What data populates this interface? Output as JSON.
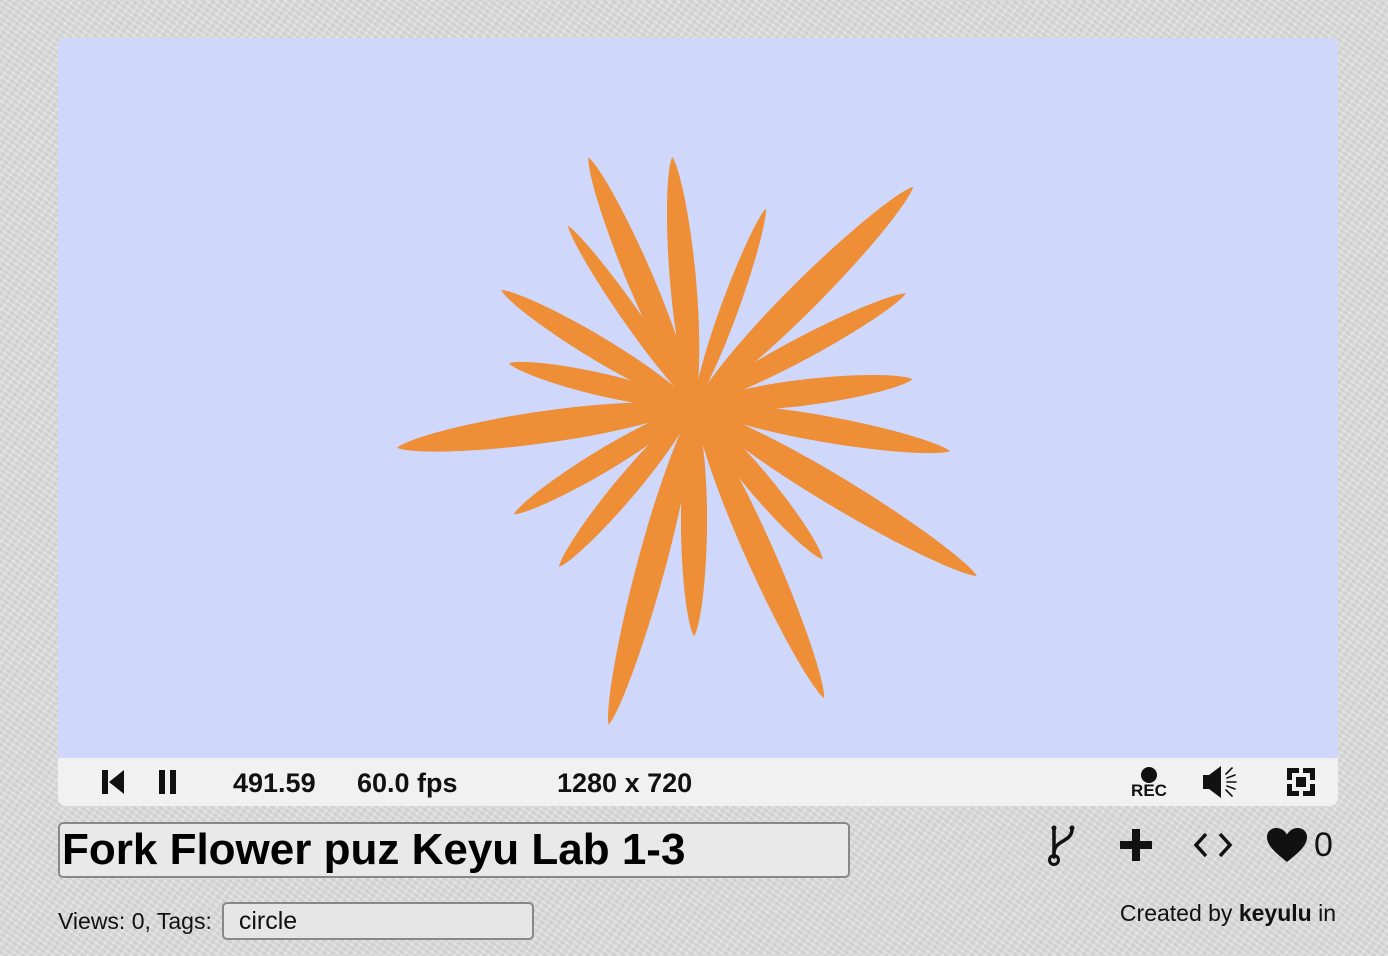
{
  "player": {
    "canvas_background": "#cfd8fa",
    "flower_color": "#ee8e36",
    "time": "491.59",
    "fps": "60.0 fps",
    "resolution": "1280 x 720",
    "rec_label": "REC"
  },
  "shader": {
    "title": "Fork Flower puz Keyu Lab 1-3",
    "views_label": "Views: 0, Tags:",
    "tags": "circle",
    "likes": "0",
    "created_by_label": "Created by",
    "author": "keyulu",
    "in_label": "in"
  },
  "icons": {
    "rewind": "skip-back-icon",
    "pause": "pause-icon",
    "record": "record-icon",
    "volume": "volume-icon",
    "fullscreen": "fullscreen-icon",
    "fork": "fork-icon",
    "add": "plus-icon",
    "embed": "code-icon",
    "like": "heart-icon"
  }
}
